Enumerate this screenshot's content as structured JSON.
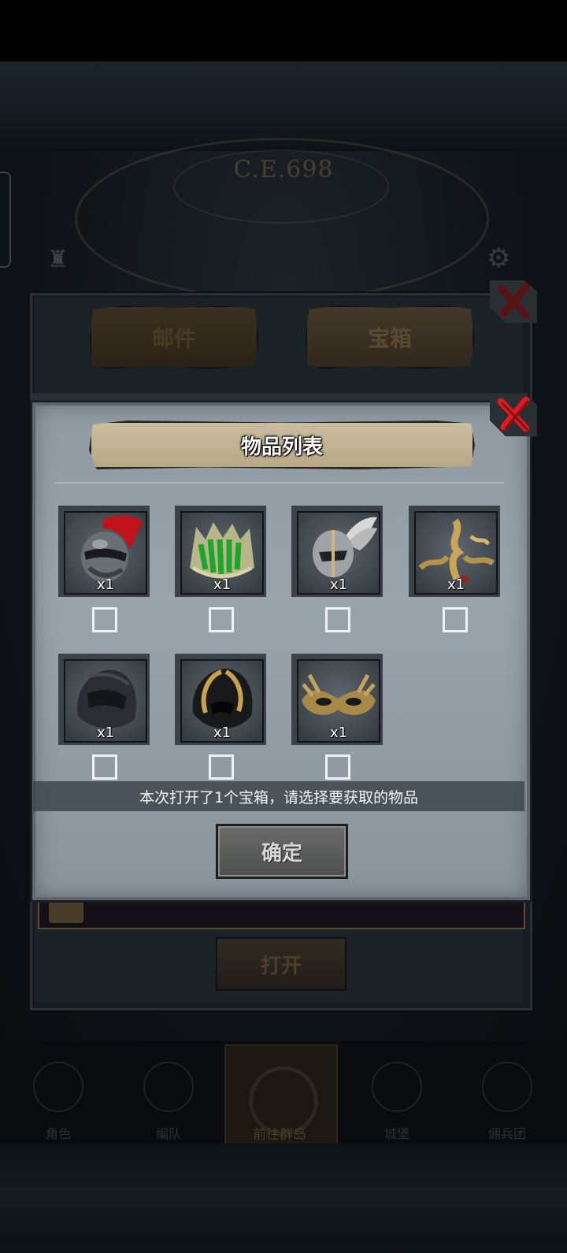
{
  "background": {
    "era_label": "C.E.698",
    "tabs": [
      {
        "label": "邮件"
      },
      {
        "label": "宝箱"
      }
    ],
    "open_button_label": "打开",
    "mail_row_text": "",
    "nav": [
      {
        "label": "角色",
        "icon": "character-icon"
      },
      {
        "label": "编队",
        "icon": "team-icon"
      },
      {
        "label": "前往群岛",
        "icon": "islands-icon"
      },
      {
        "label": "城堡",
        "icon": "castle-icon"
      },
      {
        "label": "佣兵团",
        "icon": "mercenary-icon"
      }
    ]
  },
  "dialog": {
    "title": "物品列表",
    "items": [
      {
        "name": "red-plume-knight-helmet",
        "qty": "x1"
      },
      {
        "name": "green-crystal-crown",
        "qty": "x1"
      },
      {
        "name": "winged-silver-helmet",
        "qty": "x1"
      },
      {
        "name": "golden-horned-headdress",
        "qty": "x1"
      },
      {
        "name": "black-hood",
        "qty": "x1"
      },
      {
        "name": "gold-trim-black-hood",
        "qty": "x1"
      },
      {
        "name": "golden-mask",
        "qty": "x1"
      }
    ],
    "hint": "本次打开了1个宝箱，请选择要获取的物品",
    "confirm_label": "确定"
  },
  "colors": {
    "dialog_bg": "#99a3ab",
    "close_red": "#c8161b",
    "banner": "#c4b596"
  }
}
